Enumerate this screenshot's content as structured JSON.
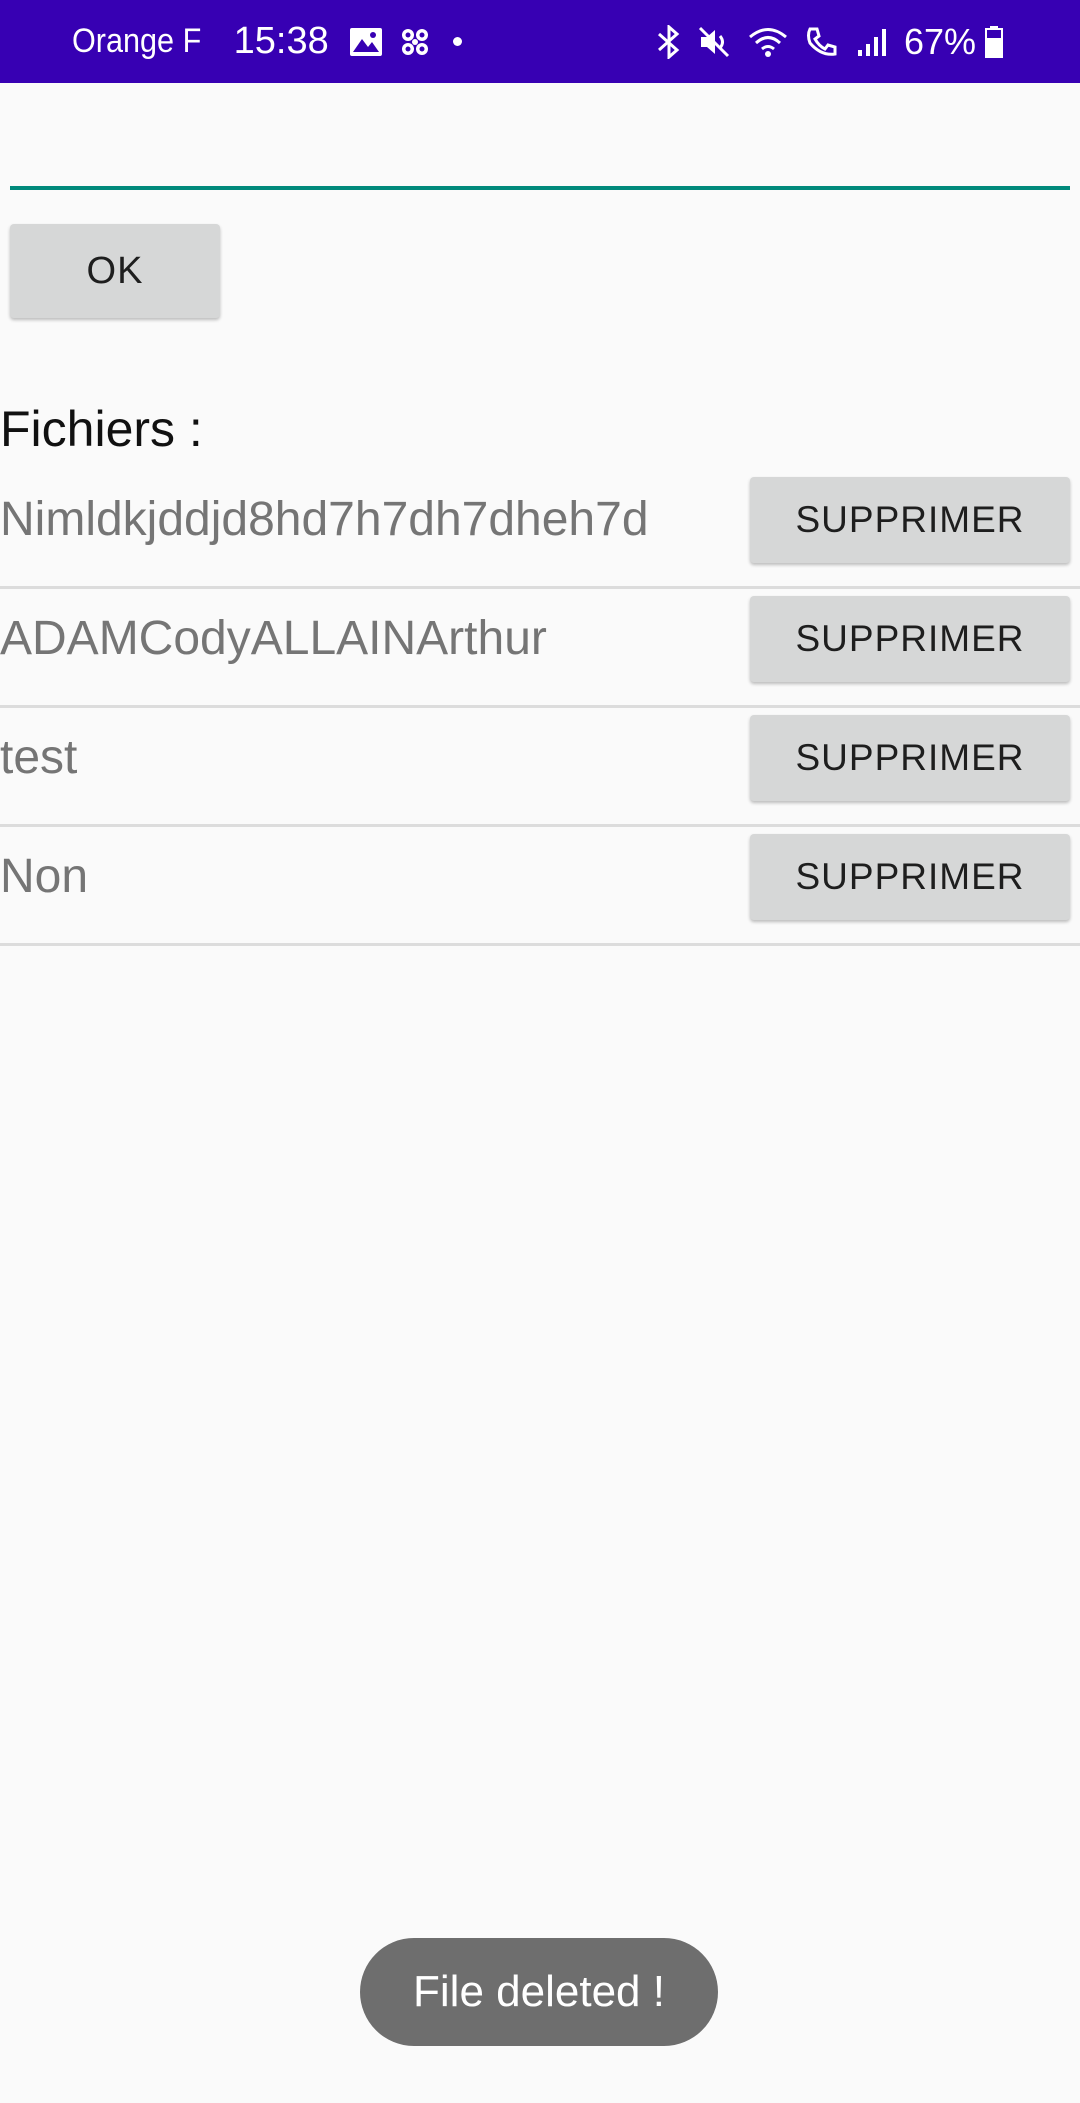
{
  "status_bar": {
    "carrier": "Orange F",
    "time": "15:38",
    "battery_percent": "67%",
    "background_color": "#3700b3",
    "left_icons": [
      "image-icon",
      "fan-icon",
      "dot-icon"
    ],
    "right_icons": [
      "bluetooth-icon",
      "mute-icon",
      "wifi-icon",
      "wifi-call-icon",
      "signal-icon",
      "battery-icon"
    ]
  },
  "input": {
    "value": "",
    "placeholder": "",
    "underline_color": "#00897b"
  },
  "ok_button": {
    "label": "OK"
  },
  "files_section": {
    "title": "Fichiers :",
    "items": [
      {
        "name": "Nimldkjddjd8hd7h7dh7dheh7d",
        "delete_label": "SUPPRIMER"
      },
      {
        "name": "ADAMCodyALLAINArthur",
        "delete_label": "SUPPRIMER"
      },
      {
        "name": "test",
        "delete_label": "SUPPRIMER"
      },
      {
        "name": "Non",
        "delete_label": "SUPPRIMER"
      }
    ]
  },
  "toast": {
    "message": "File deleted !"
  }
}
